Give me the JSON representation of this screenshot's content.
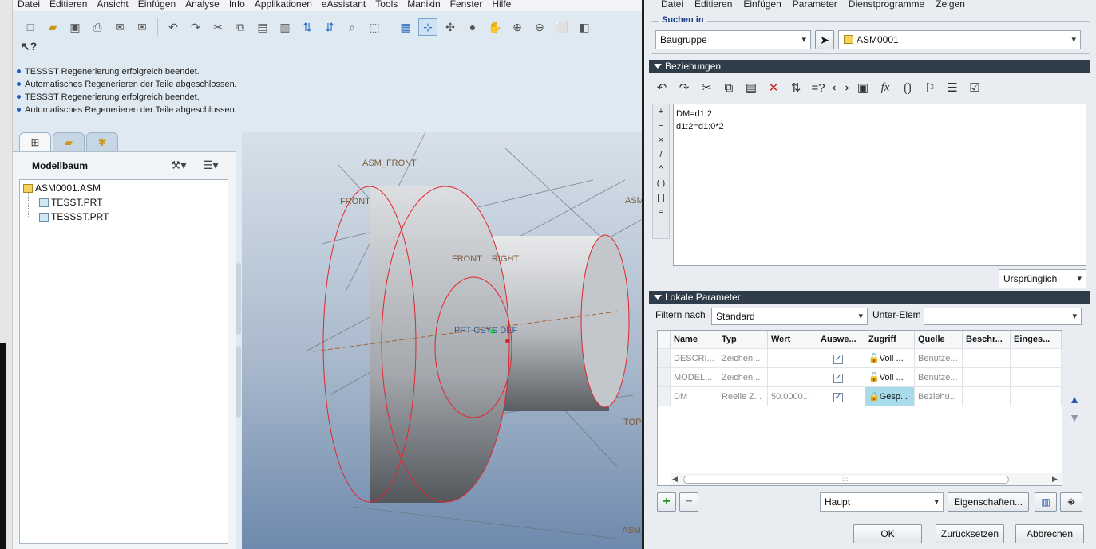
{
  "main_menu": [
    "Datei",
    "Editieren",
    "Ansicht",
    "Einfügen",
    "Analyse",
    "Info",
    "Applikationen",
    "eAssistant",
    "Tools",
    "Manikin",
    "Fenster",
    "Hilfe"
  ],
  "messages": [
    "TESSST Regenerierung erfolgreich beendet.",
    "Automatisches Regenerieren der Teile abgeschlossen.",
    "TESSST Regenerierung erfolgreich beendet.",
    "Automatisches Regenerieren der Teile abgeschlossen."
  ],
  "model_tree": {
    "title": "Modellbaum",
    "root": "ASM0001.ASM",
    "children": [
      "TESST.PRT",
      "TESSST.PRT"
    ]
  },
  "viewport_labels": {
    "asm_front": "ASM_FRONT",
    "front": "FRONT",
    "front_right": "FRONT    RIGHT",
    "csys": "PPT CSYS DEF",
    "top": "TOP",
    "asm_right": "ASM",
    "asm_bottom": "ASM_"
  },
  "dialog": {
    "menu": [
      "Datei",
      "Editieren",
      "Einfügen",
      "Parameter",
      "Dienstprogramme",
      "Zeigen"
    ],
    "search_in_label": "Suchen in",
    "search_scope": "Baugruppe",
    "search_model": "ASM0001",
    "relations_title": "Beziehungen",
    "relations_text": "DM=d1:2\nd1:2=d1:0*2",
    "relations_mode": "Ursprünglich",
    "operators": [
      "+",
      "−",
      "×",
      "/",
      "^",
      "( )",
      "[ ]",
      "="
    ],
    "local_params_title": "Lokale Parameter",
    "filter_label": "Filtern nach",
    "filter_value": "Standard",
    "subelem_label": "Unter-Elem",
    "subelem_value": "",
    "columns": [
      "Name",
      "Typ",
      "Wert",
      "Auswe...",
      "Zugriff",
      "Quelle",
      "Beschr...",
      "Einges..."
    ],
    "rows": [
      {
        "name": "DESCRI...",
        "typ": "Zeichen...",
        "wert": "",
        "ausw": "✓",
        "zugriff": "Voll  ...",
        "quelle": "Benutze...",
        "beschr": "",
        "einges": ""
      },
      {
        "name": "MODEL...",
        "typ": "Zeichen...",
        "wert": "",
        "ausw": "✓",
        "zugriff": "Voll  ...",
        "quelle": "Benutze...",
        "beschr": "",
        "einges": ""
      },
      {
        "name": "DM",
        "typ": "Reelle Z...",
        "wert": "50.0000...",
        "ausw": "✓",
        "zugriff": "Gesp...",
        "quelle": "Beziehu...",
        "beschr": "",
        "einges": ""
      }
    ],
    "scroll_grip": "::::",
    "add_label": "+",
    "remove_label": "−",
    "param_set": "Haupt",
    "properties_label": "Eigenschaften...",
    "ok_label": "OK",
    "reset_label": "Zurücksetzen",
    "cancel_label": "Abbrechen"
  }
}
